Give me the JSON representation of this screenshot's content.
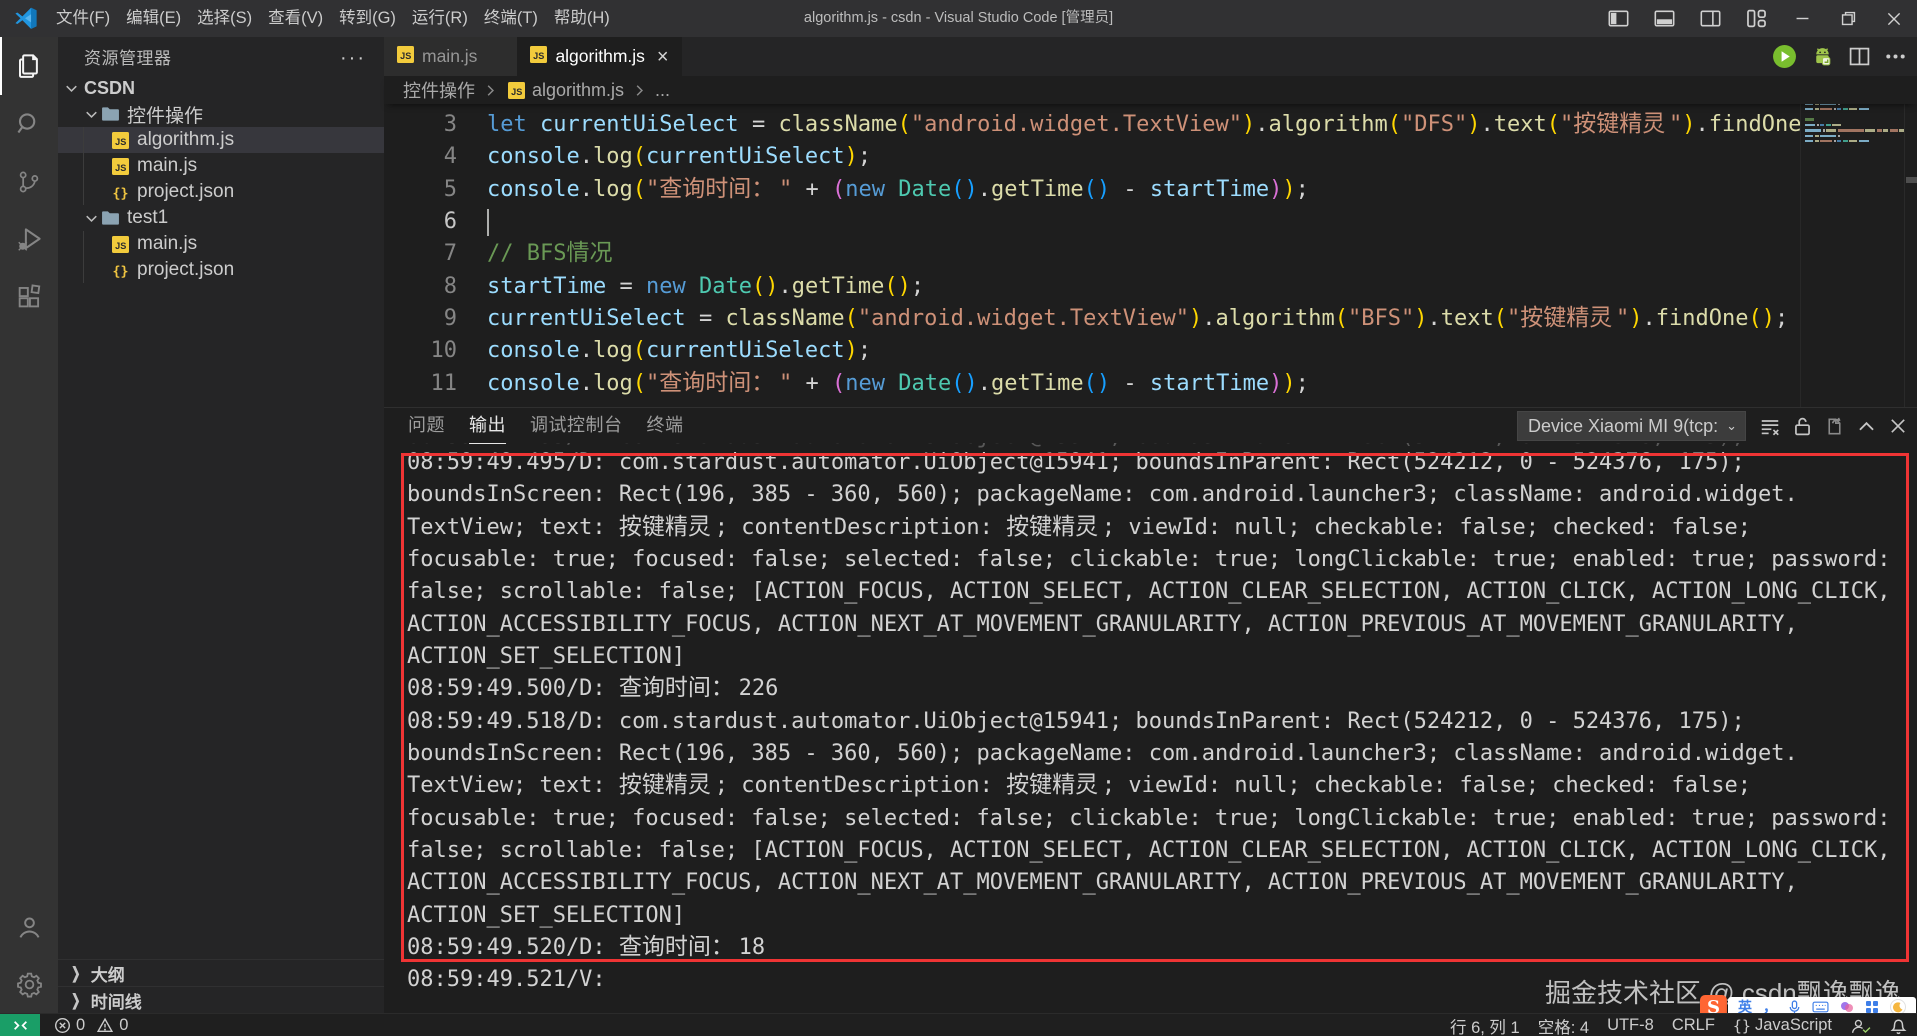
{
  "window": {
    "title": "algorithm.js - csdn - Visual Studio Code [管理员]",
    "menus": [
      "文件(F)",
      "编辑(E)",
      "选择(S)",
      "查看(V)",
      "转到(G)",
      "运行(R)",
      "终端(T)",
      "帮助(H)"
    ],
    "window_controls": [
      "toggle-sidebar",
      "toggle-panel",
      "toggle-secondary-sidebar",
      "customize-layout",
      "minimize",
      "restore",
      "close"
    ]
  },
  "activity_bar": {
    "top": [
      {
        "name": "explorer",
        "active": true
      },
      {
        "name": "search",
        "active": false
      },
      {
        "name": "source-control",
        "active": false
      },
      {
        "name": "run-debug",
        "active": false
      },
      {
        "name": "extensions",
        "active": false
      }
    ],
    "bottom": [
      {
        "name": "accounts",
        "active": false
      },
      {
        "name": "settings",
        "active": false
      }
    ]
  },
  "sidebar": {
    "header": "资源管理器",
    "more_label": "···",
    "tree": [
      {
        "label": "CSDN",
        "kind": "root",
        "indent": 0,
        "expanded": true,
        "selected": false
      },
      {
        "label": "控件操作",
        "kind": "folder",
        "indent": 1,
        "expanded": true,
        "selected": false
      },
      {
        "label": "algorithm.js",
        "kind": "js",
        "indent": 2,
        "selected": true
      },
      {
        "label": "main.js",
        "kind": "js",
        "indent": 2,
        "selected": false
      },
      {
        "label": "project.json",
        "kind": "json",
        "indent": 2,
        "selected": false
      },
      {
        "label": "test1",
        "kind": "folder",
        "indent": 1,
        "expanded": true,
        "selected": false
      },
      {
        "label": "main.js",
        "kind": "js",
        "indent": 2,
        "selected": false
      },
      {
        "label": "project.json",
        "kind": "json",
        "indent": 2,
        "selected": false
      }
    ],
    "sections": [
      "大纲",
      "时间线"
    ]
  },
  "tabs": [
    {
      "label": "main.js",
      "active": false,
      "icon": "js"
    },
    {
      "label": "algorithm.js",
      "active": true,
      "icon": "js",
      "close": "×"
    }
  ],
  "editor_actions": [
    "run",
    "autojs-connect",
    "split-editor",
    "more-actions"
  ],
  "breadcrumb": [
    "控件操作",
    "algorithm.js",
    "..."
  ],
  "syntax_colors": {
    "kw": "#569cd6",
    "var": "#9cdcfe",
    "fn": "#dcdcaa",
    "str": "#ce9178",
    "cls": "#4ec9b0",
    "op": "#d4d4d4",
    "cmt": "#6a9955",
    "p1": "#ffd700",
    "p2": "#da70d6",
    "p3": "#179fff",
    "pl": "#d4d4d4"
  },
  "editor": {
    "first_line_number": 3,
    "cursor": {
      "line": 6,
      "column": 1
    },
    "lines": [
      {
        "num": 3,
        "segs": [
          [
            "kw",
            "let"
          ],
          [
            "pl",
            " "
          ],
          [
            "var",
            "currentUiSelect"
          ],
          [
            "pl",
            " "
          ],
          [
            "op",
            "="
          ],
          [
            "pl",
            " "
          ],
          [
            "fn",
            "className"
          ],
          [
            "p1",
            "("
          ],
          [
            "str",
            "\"android.widget.TextView\""
          ],
          [
            "p1",
            ")"
          ],
          [
            "op",
            "."
          ],
          [
            "fn",
            "algorithm"
          ],
          [
            "p1",
            "("
          ],
          [
            "str",
            "\"DFS\""
          ],
          [
            "p1",
            ")"
          ],
          [
            "op",
            "."
          ],
          [
            "fn",
            "text"
          ],
          [
            "p1",
            "("
          ],
          [
            "str",
            "\"按键精灵\""
          ],
          [
            "p1",
            ")"
          ],
          [
            "op",
            "."
          ],
          [
            "fn",
            "findOne"
          ],
          [
            "p1",
            "()"
          ],
          [
            "op",
            ";"
          ]
        ]
      },
      {
        "num": 4,
        "segs": [
          [
            "var",
            "console"
          ],
          [
            "op",
            "."
          ],
          [
            "fn",
            "log"
          ],
          [
            "p1",
            "("
          ],
          [
            "var",
            "currentUiSelect"
          ],
          [
            "p1",
            ")"
          ],
          [
            "op",
            ";"
          ]
        ]
      },
      {
        "num": 5,
        "segs": [
          [
            "var",
            "console"
          ],
          [
            "op",
            "."
          ],
          [
            "fn",
            "log"
          ],
          [
            "p1",
            "("
          ],
          [
            "str",
            "\"查询时间：\""
          ],
          [
            "pl",
            " "
          ],
          [
            "op",
            "+"
          ],
          [
            "pl",
            " "
          ],
          [
            "p2",
            "("
          ],
          [
            "kw",
            "new"
          ],
          [
            "pl",
            " "
          ],
          [
            "cls",
            "Date"
          ],
          [
            "p3",
            "()"
          ],
          [
            "op",
            "."
          ],
          [
            "fn",
            "getTime"
          ],
          [
            "p3",
            "()"
          ],
          [
            "pl",
            " "
          ],
          [
            "op",
            "-"
          ],
          [
            "pl",
            " "
          ],
          [
            "var",
            "startTime"
          ],
          [
            "p2",
            ")"
          ],
          [
            "p1",
            ")"
          ],
          [
            "op",
            ";"
          ]
        ]
      },
      {
        "num": 6,
        "segs": []
      },
      {
        "num": 7,
        "segs": [
          [
            "cmt",
            "// BFS情况"
          ]
        ]
      },
      {
        "num": 8,
        "segs": [
          [
            "var",
            "startTime"
          ],
          [
            "pl",
            " "
          ],
          [
            "op",
            "="
          ],
          [
            "pl",
            " "
          ],
          [
            "kw",
            "new"
          ],
          [
            "pl",
            " "
          ],
          [
            "cls",
            "Date"
          ],
          [
            "p1",
            "()"
          ],
          [
            "op",
            "."
          ],
          [
            "fn",
            "getTime"
          ],
          [
            "p1",
            "()"
          ],
          [
            "op",
            ";"
          ]
        ]
      },
      {
        "num": 9,
        "segs": [
          [
            "var",
            "currentUiSelect"
          ],
          [
            "pl",
            " "
          ],
          [
            "op",
            "="
          ],
          [
            "pl",
            " "
          ],
          [
            "fn",
            "className"
          ],
          [
            "p1",
            "("
          ],
          [
            "str",
            "\"android.widget.TextView\""
          ],
          [
            "p1",
            ")"
          ],
          [
            "op",
            "."
          ],
          [
            "fn",
            "algorithm"
          ],
          [
            "p1",
            "("
          ],
          [
            "str",
            "\"BFS\""
          ],
          [
            "p1",
            ")"
          ],
          [
            "op",
            "."
          ],
          [
            "fn",
            "text"
          ],
          [
            "p1",
            "("
          ],
          [
            "str",
            "\"按键精灵\""
          ],
          [
            "p1",
            ")"
          ],
          [
            "op",
            "."
          ],
          [
            "fn",
            "findOne"
          ],
          [
            "p1",
            "()"
          ],
          [
            "op",
            ";"
          ]
        ]
      },
      {
        "num": 10,
        "segs": [
          [
            "var",
            "console"
          ],
          [
            "op",
            "."
          ],
          [
            "fn",
            "log"
          ],
          [
            "p1",
            "("
          ],
          [
            "var",
            "currentUiSelect"
          ],
          [
            "p1",
            ")"
          ],
          [
            "op",
            ";"
          ]
        ]
      },
      {
        "num": 11,
        "segs": [
          [
            "var",
            "console"
          ],
          [
            "op",
            "."
          ],
          [
            "fn",
            "log"
          ],
          [
            "p1",
            "("
          ],
          [
            "str",
            "\"查询时间：\""
          ],
          [
            "pl",
            " "
          ],
          [
            "op",
            "+"
          ],
          [
            "pl",
            " "
          ],
          [
            "p2",
            "("
          ],
          [
            "kw",
            "new"
          ],
          [
            "pl",
            " "
          ],
          [
            "cls",
            "Date"
          ],
          [
            "p3",
            "()"
          ],
          [
            "op",
            "."
          ],
          [
            "fn",
            "getTime"
          ],
          [
            "p3",
            "()"
          ],
          [
            "pl",
            " "
          ],
          [
            "op",
            "-"
          ],
          [
            "pl",
            " "
          ],
          [
            "var",
            "startTime"
          ],
          [
            "p2",
            ")"
          ],
          [
            "p1",
            ")"
          ],
          [
            "op",
            ";"
          ]
        ]
      }
    ]
  },
  "minimap_rows": [
    {
      "segs": [
        [
          "cmt",
          12
        ]
      ]
    },
    {
      "segs": [
        [
          "kw",
          4
        ],
        [
          "var",
          10
        ],
        [
          "op",
          2
        ],
        [
          "kw",
          4
        ],
        [
          "cls",
          5
        ],
        [
          "fn",
          9
        ]
      ]
    },
    {
      "segs": [
        [
          "kw",
          4
        ],
        [
          "var",
          16
        ],
        [
          "fn",
          10
        ],
        [
          "str",
          26
        ],
        [
          "fn",
          10
        ],
        [
          "str",
          5
        ],
        [
          "fn",
          5
        ],
        [
          "str",
          8
        ],
        [
          "fn",
          8
        ]
      ]
    },
    {
      "segs": [
        [
          "var",
          8
        ],
        [
          "fn",
          4
        ],
        [
          "var",
          16
        ],
        [
          "op",
          2
        ]
      ]
    },
    {
      "segs": [
        [
          "var",
          8
        ],
        [
          "fn",
          4
        ],
        [
          "str",
          12
        ],
        [
          "op",
          2
        ],
        [
          "kw",
          4
        ],
        [
          "cls",
          5
        ],
        [
          "fn",
          8
        ],
        [
          "var",
          10
        ]
      ]
    },
    {
      "segs": []
    },
    {
      "segs": [
        [
          "cmt",
          9
        ]
      ]
    },
    {
      "segs": [
        [
          "var",
          10
        ],
        [
          "op",
          2
        ],
        [
          "kw",
          4
        ],
        [
          "cls",
          5
        ],
        [
          "fn",
          9
        ]
      ]
    },
    {
      "segs": [
        [
          "var",
          16
        ],
        [
          "op",
          2
        ],
        [
          "fn",
          10
        ],
        [
          "str",
          26
        ],
        [
          "fn",
          10
        ],
        [
          "str",
          5
        ],
        [
          "fn",
          5
        ],
        [
          "str",
          8
        ],
        [
          "fn",
          8
        ]
      ]
    },
    {
      "segs": [
        [
          "var",
          8
        ],
        [
          "fn",
          4
        ],
        [
          "var",
          16
        ],
        [
          "op",
          2
        ]
      ]
    },
    {
      "segs": [
        [
          "var",
          8
        ],
        [
          "fn",
          4
        ],
        [
          "str",
          12
        ],
        [
          "op",
          2
        ],
        [
          "kw",
          4
        ],
        [
          "cls",
          5
        ],
        [
          "fn",
          8
        ],
        [
          "var",
          10
        ]
      ]
    }
  ],
  "panel": {
    "tabs": [
      {
        "label": "问题",
        "active": false
      },
      {
        "label": "输出",
        "active": true
      },
      {
        "label": "调试控制台",
        "active": false
      },
      {
        "label": "终端",
        "active": false
      }
    ],
    "device_selector": "Device Xiaomi MI 9(tcp:",
    "actions": [
      "clear-output",
      "unlock",
      "open-in-editor",
      "maximize-panel",
      "close-panel"
    ],
    "clipped_line": "08:59:49.495/D: com.stardust.automator.UiObject@15941; boundsInParent: Rect(524212, 0 - 524376, 175);",
    "output_lines": [
      "08:59:49.495/D: com.stardust.automator.UiObject@15941; boundsInParent: Rect(524212, 0 - 524376, 175);",
      "boundsInScreen: Rect(196, 385 - 360, 560); packageName: com.android.launcher3; className: android.widget.",
      "TextView; text: 按键精灵; contentDescription: 按键精灵; viewId: null; checkable: false; checked: false;",
      "focusable: true; focused: false; selected: false; clickable: true; longClickable: true; enabled: true; password:",
      "false; scrollable: false; [ACTION_FOCUS, ACTION_SELECT, ACTION_CLEAR_SELECTION, ACTION_CLICK, ACTION_LONG_CLICK,",
      "ACTION_ACCESSIBILITY_FOCUS, ACTION_NEXT_AT_MOVEMENT_GRANULARITY, ACTION_PREVIOUS_AT_MOVEMENT_GRANULARITY,",
      "ACTION_SET_SELECTION]",
      "08:59:49.500/D: 查询时间：226",
      "08:59:49.518/D: com.stardust.automator.UiObject@15941; boundsInParent: Rect(524212, 0 - 524376, 175);",
      "boundsInScreen: Rect(196, 385 - 360, 560); packageName: com.android.launcher3; className: android.widget.",
      "TextView; text: 按键精灵; contentDescription: 按键精灵; viewId: null; checkable: false; checked: false;",
      "focusable: true; focused: false; selected: false; clickable: true; longClickable: true; enabled: true; password:",
      "false; scrollable: false; [ACTION_FOCUS, ACTION_SELECT, ACTION_CLEAR_SELECTION, ACTION_CLICK, ACTION_LONG_CLICK,",
      "ACTION_ACCESSIBILITY_FOCUS, ACTION_NEXT_AT_MOVEMENT_GRANULARITY, ACTION_PREVIOUS_AT_MOVEMENT_GRANULARITY,",
      "ACTION_SET_SELECTION]",
      "08:59:49.520/D: 查询时间：18",
      "08:59:49.521/V:"
    ],
    "boxed_line_count": 16
  },
  "status_bar": {
    "remote_indicator": "remote",
    "errors": "0",
    "warnings": "0",
    "right": [
      {
        "name": "cursor-position",
        "label": "行 6, 列 1"
      },
      {
        "name": "indentation",
        "label": "空格: 4"
      },
      {
        "name": "encoding",
        "label": "UTF-8"
      },
      {
        "name": "eol",
        "label": "CRLF"
      },
      {
        "name": "language-mode",
        "label": "JavaScript",
        "icon": "{}"
      },
      {
        "name": "autojs-status",
        "label": "",
        "icon": "person-check"
      },
      {
        "name": "notifications",
        "label": "",
        "icon": "bell"
      }
    ],
    "accent": "#1a9e67"
  },
  "theme_colors": {
    "title_bar": "#313133",
    "activity_bar": "#333333",
    "sidebar": "#252526",
    "editor_background": "#1e1e1e",
    "tab_active": "#1e1e1e",
    "tab_inactive": "#2d2d2d",
    "status_bar": "#1f1f1f",
    "remote_chip": "#1a9e67",
    "selection_row": "#37373d",
    "red_annotation": "#ef3434",
    "js_icon": "#f2cb3c"
  },
  "watermark": "掘金技术社区 @ csdn飘逸飘逸",
  "ime_bar": {
    "logo": "S",
    "items": [
      "英",
      "，",
      "mic",
      "keyboard",
      "skin",
      "grid",
      "moon"
    ]
  }
}
